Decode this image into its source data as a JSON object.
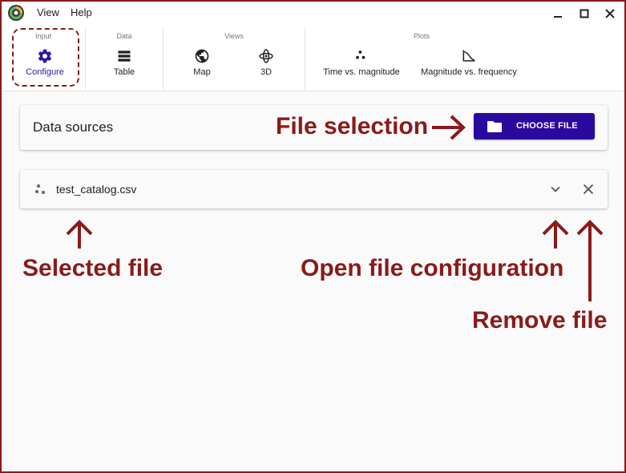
{
  "titlebar": {
    "menu": [
      {
        "label": "View"
      },
      {
        "label": "Help"
      }
    ]
  },
  "ribbon": {
    "groups": [
      {
        "title": "Input",
        "buttons": [
          {
            "label": "Configure",
            "icon": "gear-icon",
            "active": true
          }
        ]
      },
      {
        "title": "Data",
        "buttons": [
          {
            "label": "Table",
            "icon": "table-icon"
          }
        ]
      },
      {
        "title": "Views",
        "buttons": [
          {
            "label": "Map",
            "icon": "globe-icon"
          },
          {
            "label": "3D",
            "icon": "orbit-3d-icon"
          }
        ]
      },
      {
        "title": "Plots",
        "buttons": [
          {
            "label": "Time vs. magnitude",
            "icon": "scatter-icon"
          },
          {
            "label": "Magnitude vs. frequency",
            "icon": "curve-icon"
          }
        ]
      }
    ]
  },
  "sources": {
    "title": "Data sources",
    "choose_label": "CHOOSE FILE"
  },
  "file": {
    "name": "test_catalog.csv"
  },
  "annotations": {
    "file_selection": "File selection",
    "selected_file": "Selected file",
    "open_config": "Open file configuration",
    "remove_file": "Remove file"
  },
  "colors": {
    "accent": "#2a0a9e",
    "annotation": "#8b1a1a",
    "border": "#8b1a1a"
  }
}
